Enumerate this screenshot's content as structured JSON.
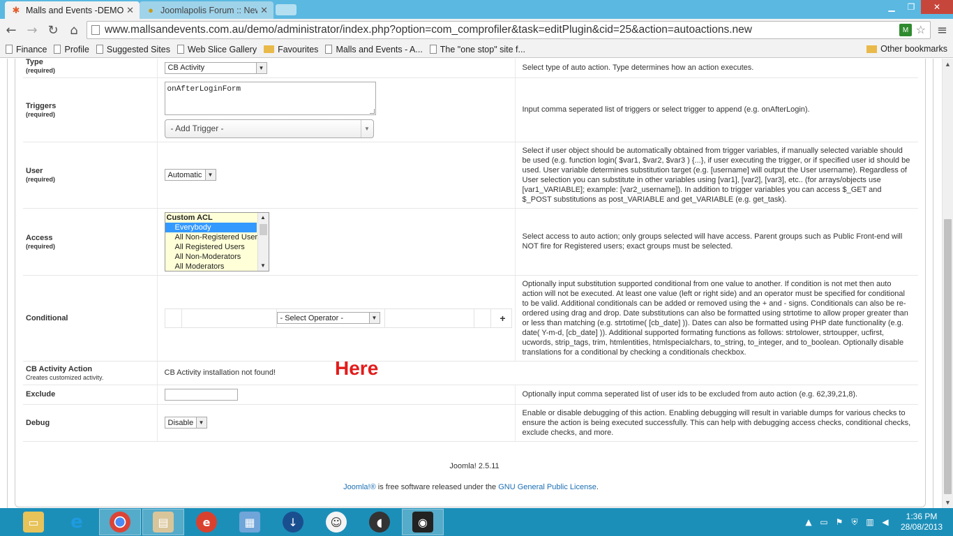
{
  "browser": {
    "tabs": [
      {
        "title": "Malls and Events -DEMO S",
        "active": true
      },
      {
        "title": "Joomlapolis Forum :: New",
        "active": false
      }
    ],
    "url": "www.mallsandevents.com.au/demo/administrator/index.php?option=com_comprofiler&task=editPlugin&cid=25&action=autoactions.new",
    "bookmarks": [
      {
        "label": "Finance",
        "type": "page"
      },
      {
        "label": "Profile",
        "type": "page"
      },
      {
        "label": "Suggested Sites",
        "type": "page"
      },
      {
        "label": "Web Slice Gallery",
        "type": "page"
      },
      {
        "label": "Favourites",
        "type": "folder"
      },
      {
        "label": "Malls and Events - A...",
        "type": "page"
      },
      {
        "label": "The \"one stop\" site f...",
        "type": "page"
      }
    ],
    "other_bookmarks": "Other bookmarks"
  },
  "form": {
    "type": {
      "label": "Type",
      "required": "(required)",
      "value": "CB Activity",
      "description": "Select type of auto action. Type determines how an action executes."
    },
    "triggers": {
      "label": "Triggers",
      "required": "(required)",
      "value": "onAfterLoginForm",
      "add_trigger": "- Add Trigger -",
      "description": "Input comma seperated list of triggers or select trigger to append (e.g. onAfterLogin)."
    },
    "user": {
      "label": "User",
      "required": "(required)",
      "value": "Automatic",
      "description": "Select if user object should be automatically obtained from trigger variables, if manually selected variable should be used (e.g. function login( $var1, $var2, $var3 ) {...}, if user executing the trigger, or if specified user id should be used. User variable determines substitution target (e.g. [username] will output the User username). Regardless of User selection you can substitute in other variables using [var1], [var2], [var3], etc.. (for arrays/objects use [var1_VARIABLE]; example: [var2_username]). In addition to trigger variables you can access $_GET and $_POST substitutions as post_VARIABLE and get_VARIABLE (e.g. get_task)."
    },
    "access": {
      "label": "Access",
      "required": "(required)",
      "group": "Custom ACL",
      "options": [
        "Everybody",
        "All Non-Registered Users",
        "All Registered Users",
        "All Non-Moderators",
        "All Moderators"
      ],
      "selected": "Everybody",
      "description": "Select access to auto action; only groups selected will have access. Parent groups such as Public Front-end will NOT fire for Registered users; exact groups must be selected."
    },
    "conditional": {
      "label": "Conditional",
      "operator": "- Select Operator -",
      "add": "+",
      "description": "Optionally input substitution supported conditional from one value to another. If condition is not met then auto action will not be executed. At least one value (left or right side) and an operator must be specified for conditional to be valid. Additional conditionals can be added or removed using the + and - signs. Conditionals can also be re-ordered using drag and drop. Date substitutions can also be formatted using strtotime to allow proper greater than or less than matching (e.g. strtotime( [cb_date] )). Dates can also be formatted using PHP date functionality (e.g. date( Y-m-d, [cb_date] )). Additional supported formating functions as follows: strtolower, strtoupper, ucfirst, ucwords, strip_tags, trim, htmlentities, htmlspecialchars, to_string, to_integer, and to_boolean. Optionally disable translations for a conditional by checking a conditionals checkbox."
    },
    "cb_activity_action": {
      "label": "CB Activity Action",
      "sub": "Creates customized activity.",
      "message": "CB Activity installation not found!"
    },
    "exclude": {
      "label": "Exclude",
      "value": "",
      "description": "Optionally input comma seperated list of user ids to be excluded from auto action (e.g. 62,39,21,8)."
    },
    "debug": {
      "label": "Debug",
      "value": "Disable",
      "description": "Enable or disable debugging of this action. Enabling debugging will result in variable dumps for various checks to ensure the action is being executed successfully. This can help with debugging access checks, conditional checks, exclude checks, and more."
    }
  },
  "annotation": "Here",
  "footer": {
    "version": "Joomla! 2.5.11",
    "joomla_link": "Joomla!®",
    "license_mid": " is free software released under the ",
    "license_link": "GNU General Public License",
    "license_end": "."
  },
  "taskbar": {
    "time": "1:36 PM",
    "date": "28/08/2013"
  },
  "colors": {
    "titlebar": "#5ab8e1",
    "taskbar": "#1c8fb9",
    "annotation": "#e31b1b",
    "selected_option": "#3399ff"
  }
}
